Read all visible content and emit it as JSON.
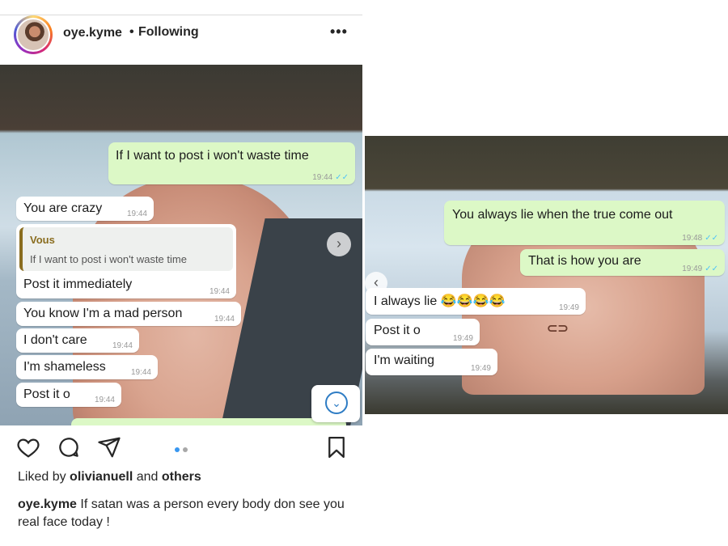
{
  "post": {
    "username": "oye.kyme",
    "dot": "•",
    "following": "Following",
    "more": "•••",
    "likes_prefix": "Liked by",
    "likes_user": "olivianuell",
    "likes_and": "and",
    "likes_others": "others",
    "caption_user": "oye.kyme",
    "caption_text": "If satan was a person every body don see you real face today !",
    "carousel_index": 1,
    "carousel_count": 2
  },
  "chat1": {
    "messages": [
      {
        "dir": "out",
        "text": "If I want to post i won't waste time",
        "time": "19:44"
      },
      {
        "dir": "in",
        "text": "You are crazy",
        "time": "19:44"
      },
      {
        "dir": "in",
        "quote_who": "Vous",
        "quote_text": "If I want to post i won't waste time",
        "text": "Post it immediately",
        "time": "19:44"
      },
      {
        "dir": "in",
        "text": "You know I'm a mad person",
        "time": "19:44"
      },
      {
        "dir": "in",
        "text": "I don't care",
        "time": "19:44"
      },
      {
        "dir": "in",
        "text": "I'm shameless",
        "time": "19:44"
      },
      {
        "dir": "in",
        "text": "Post it o",
        "time": "19:44"
      }
    ]
  },
  "chat2": {
    "messages": [
      {
        "dir": "out",
        "text": "You always lie when the true come out",
        "time": "19:48"
      },
      {
        "dir": "out",
        "text": "That is how you are",
        "time": "19:49"
      },
      {
        "dir": "in",
        "text": "I always lie 😂😂😂😂",
        "time": "19:49"
      },
      {
        "dir": "in",
        "text": "Post it o",
        "time": "19:49"
      },
      {
        "dir": "in",
        "text": "I'm waiting",
        "time": "19:49"
      }
    ]
  },
  "icons": {
    "heart": "heart-icon",
    "comment": "comment-icon",
    "share": "share-icon",
    "save": "bookmark-icon",
    "next": "chevron-right-icon",
    "prev": "chevron-left-icon",
    "scroll": "chevron-down-icon"
  },
  "colors": {
    "outgoing_bubble": "#dcf8c6",
    "incoming_bubble": "#ffffff",
    "tick_blue": "#4fc3f7",
    "carousel_active": "#3897f0"
  }
}
